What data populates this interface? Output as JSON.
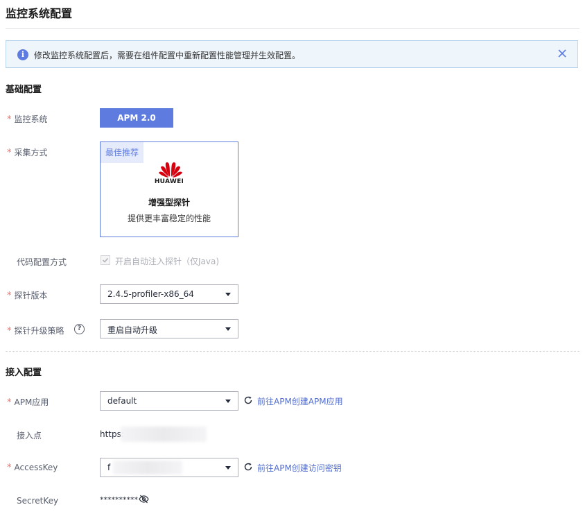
{
  "page": {
    "title": "监控系统配置"
  },
  "alert": {
    "message": "修改监控系统配置后，需要在组件配置中重新配置性能管理并生效配置。",
    "info_icon": "i"
  },
  "basic": {
    "section_title": "基础配置",
    "monitor_system": {
      "label": "监控系统",
      "value": "APM 2.0"
    },
    "collection": {
      "label": "采集方式",
      "badge": "最佳推荐",
      "brand": "HUAWEI",
      "name": "增强型探针",
      "description": "提供更丰富稳定的性能"
    },
    "code_config": {
      "label": "代码配置方式",
      "checkbox_label": "开启自动注入探针（仅Java)",
      "checked": true
    },
    "probe_version": {
      "label": "探针版本",
      "value": "2.4.5-profiler-x86_64"
    },
    "upgrade_policy": {
      "label": "探针升级策略",
      "value": "重启自动升级",
      "help": "?"
    }
  },
  "access": {
    "section_title": "接入配置",
    "apm_app": {
      "label": "APM应用",
      "value": "default",
      "link": "前往APM创建APM应用"
    },
    "endpoint": {
      "label": "接入点",
      "value": "https:"
    },
    "access_key": {
      "label": "AccessKey",
      "value": "f",
      "link": "前往APM创建访问密钥"
    },
    "secret_key": {
      "label": "SecretKey",
      "value": "**********"
    }
  },
  "colors": {
    "primary": "#5e7ce0",
    "required": "#f66f6a",
    "link": "#526ecc"
  }
}
